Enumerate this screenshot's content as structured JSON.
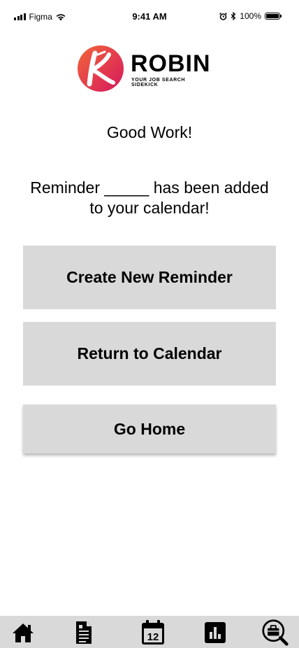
{
  "status_bar": {
    "carrier": "Figma",
    "time": "9:41 AM",
    "battery": "100%",
    "icons": [
      "signal-icon",
      "wifi-icon",
      "alarm-icon",
      "bluetooth-icon",
      "battery-icon"
    ]
  },
  "logo": {
    "name": "ROBIN",
    "tagline": "YOUR JOB SEARCH SIDEKICK",
    "colors": {
      "gradient_start": "#f2663a",
      "gradient_end": "#d6185e"
    }
  },
  "main": {
    "heading": "Good Work!",
    "message": "Reminder _____ has been added to your calendar!"
  },
  "buttons": {
    "create_new_reminder": "Create New Reminder",
    "return_to_calendar": "Return to Calendar",
    "go_home": "Go Home"
  },
  "tab_bar": {
    "calendar_day": "12",
    "items": [
      "home-icon",
      "document-icon",
      "calendar-icon",
      "stats-icon",
      "job-search-icon"
    ]
  },
  "colors": {
    "button_bg": "#d9d9d9",
    "tab_bar_bg": "#d9d9d9",
    "text": "#000000",
    "background": "#ffffff"
  }
}
